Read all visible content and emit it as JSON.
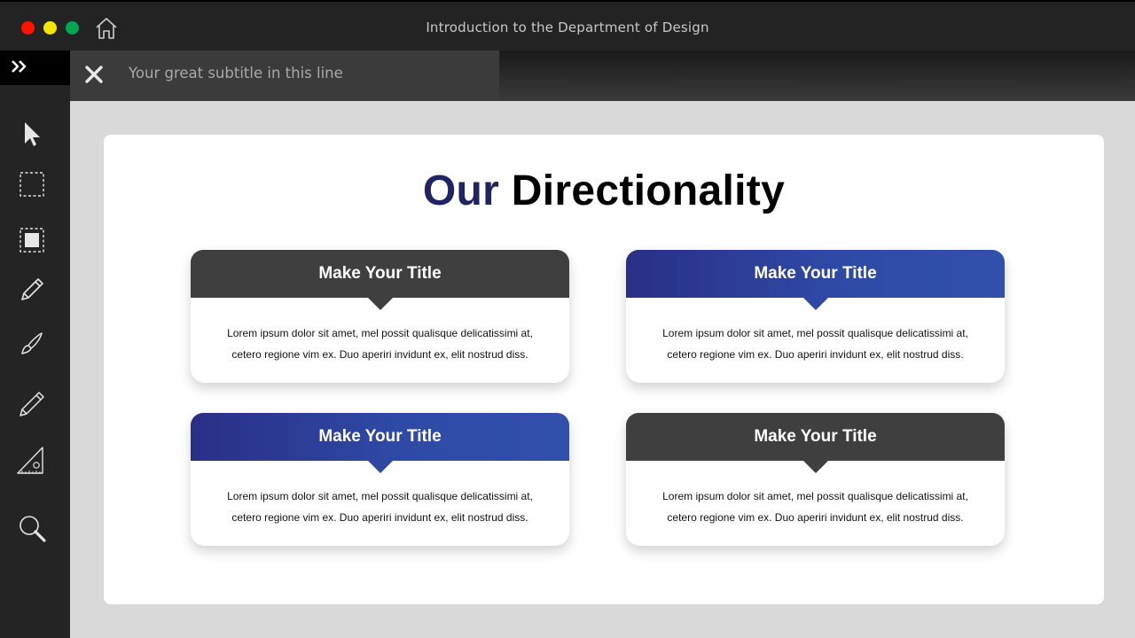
{
  "window": {
    "title": "Introduction to the Department of Design",
    "controls": {
      "close_color": "#ff1200",
      "minimize_color": "#f2e500",
      "maximize_color": "#00a651"
    }
  },
  "subtitle_bar": {
    "text": "Your great subtitle in this line"
  },
  "sidebar": {
    "tools": [
      "pointer-icon",
      "marquee-select-icon",
      "filled-select-icon",
      "pencil-icon",
      "brush-icon",
      "pen-icon",
      "ruler-triangle-icon",
      "magnifier-icon"
    ]
  },
  "slide": {
    "title_accent": "Our",
    "title_rest": "Directionality",
    "accent_color": "#1f2463",
    "cards": [
      {
        "title": "Make Your Title",
        "body_line1": "Lorem  ipsum dolor sit amet, mel  possit qualisque delicatissimi at,",
        "body_line2": "cetero  regione vim ex.  Duo aperiri invidunt ex, elit nostrud diss.",
        "theme": "dark"
      },
      {
        "title": "Make Your Title",
        "body_line1": "Lorem  ipsum dolor sit amet, mel  possit qualisque delicatissimi at,",
        "body_line2": "cetero  regione vim ex.  Duo aperiri invidunt ex, elit nostrud diss.",
        "theme": "blue"
      },
      {
        "title": "Make Your Title",
        "body_line1": "Lorem  ipsum dolor sit amet, mel  possit qualisque delicatissimi at,",
        "body_line2": "cetero  regione vim ex.  Duo aperiri invidunt ex, elit nostrud diss.",
        "theme": "blue"
      },
      {
        "title": "Make Your Title",
        "body_line1": "Lorem  ipsum dolor sit amet, mel  possit qualisque delicatissimi at,",
        "body_line2": "cetero  regione vim ex.  Duo aperiri invidunt ex, elit nostrud diss.",
        "theme": "dark"
      }
    ]
  }
}
